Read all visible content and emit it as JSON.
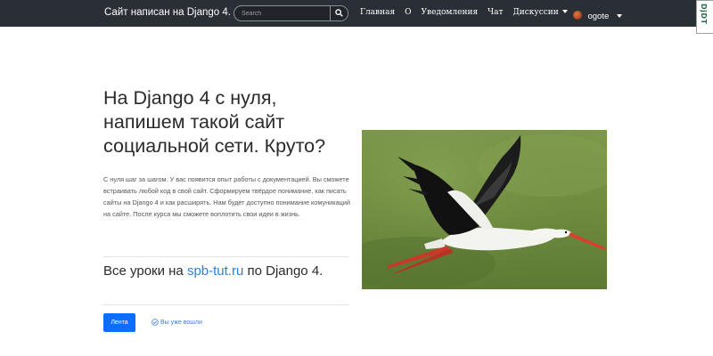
{
  "navbar": {
    "brand": "Сайт написан на Django 4.",
    "search_placeholder": "Search",
    "items": [
      {
        "label": "Главная"
      },
      {
        "label": "О"
      },
      {
        "label": "Уведомления"
      },
      {
        "label": "Чат"
      },
      {
        "label": "Дискуссии",
        "dropdown": true
      }
    ],
    "user": {
      "name": "ogote",
      "dropdown": true
    }
  },
  "debug_toolbar": {
    "label": "DjDT"
  },
  "hero": {
    "headline": "На Django 4 с нуля, напишем такой сайт социальной сети. Круто?",
    "lead": "С нуля шаг за шагом. У вас появится опыт работы с документацией. Вы сможете встраивать любой код в свой сайт. Сформируем твёрдое понимание, как писать сайты на Django 4 и как расширять. Нам будет доступно понимание комуникаций на сайте. После курса мы сможете воплотить свои идеи в жизнь.",
    "lessons_prefix": "Все уроки на ",
    "lessons_link": "spb-tut.ru",
    "lessons_suffix": " по Django 4.",
    "feed_button": "Лента",
    "logged_in_text": "Вы уже вошли"
  },
  "colors": {
    "navbar_bg": "#2a2e35",
    "primary_button": "#0d6efd",
    "link": "#2f7de1"
  }
}
